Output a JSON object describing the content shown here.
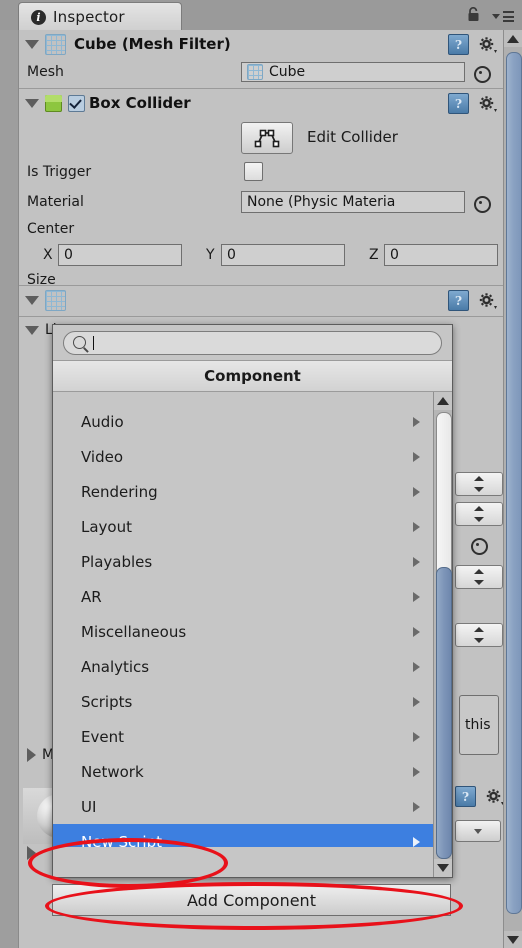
{
  "window": {
    "tab_label": "Inspector",
    "tab_icon": "info-circle-icon",
    "lock_icon": "lock-icon",
    "menu_icon": "hamburger-menu-icon"
  },
  "components": [
    {
      "id": "mesh-filter",
      "title": "Cube (Mesh Filter)",
      "icon": "mesh-filter-icon",
      "help_glyph": "?",
      "rows": [
        {
          "label": "Mesh",
          "value": "Cube",
          "picker": "object-picker-icon"
        }
      ]
    },
    {
      "id": "box-collider",
      "title": "Box Collider",
      "icon": "box-collider-icon",
      "enabled": true,
      "help_glyph": "?",
      "edit_collider_label": "Edit Collider",
      "edit_collider_icon": "polygon-edit-icon",
      "rows": [
        {
          "label": "Is Trigger",
          "type": "checkbox",
          "value": false
        },
        {
          "label": "Material",
          "value": "None (Physic Materia",
          "picker": "object-picker-icon"
        },
        {
          "label": "Center",
          "type": "vector3",
          "x": "0",
          "y": "0",
          "z": "0"
        },
        {
          "label": "Size",
          "type": "vector3"
        }
      ],
      "axis_labels": {
        "x": "X",
        "y": "Y",
        "z": "Z"
      }
    },
    {
      "id": "light",
      "title": "Li",
      "icon": "light-icon"
    },
    {
      "id": "material-collapsed",
      "title": "M"
    }
  ],
  "obscured": {
    "help_text_fragment": "this"
  },
  "popup": {
    "title": "Component",
    "search_placeholder": "",
    "search_value": "",
    "search_icon": "search-icon",
    "items": [
      {
        "label": "Audio",
        "has_submenu": true,
        "selected": false
      },
      {
        "label": "Video",
        "has_submenu": true,
        "selected": false
      },
      {
        "label": "Rendering",
        "has_submenu": true,
        "selected": false
      },
      {
        "label": "Layout",
        "has_submenu": true,
        "selected": false
      },
      {
        "label": "Playables",
        "has_submenu": true,
        "selected": false
      },
      {
        "label": "AR",
        "has_submenu": true,
        "selected": false
      },
      {
        "label": "Miscellaneous",
        "has_submenu": true,
        "selected": false
      },
      {
        "label": "Analytics",
        "has_submenu": true,
        "selected": false
      },
      {
        "label": "Scripts",
        "has_submenu": true,
        "selected": false
      },
      {
        "label": "Event",
        "has_submenu": true,
        "selected": false
      },
      {
        "label": "Network",
        "has_submenu": true,
        "selected": false
      },
      {
        "label": "UI",
        "has_submenu": true,
        "selected": false
      },
      {
        "label": "New Script",
        "has_submenu": true,
        "selected": true
      }
    ],
    "scrollbar": {
      "up_icon": "scroll-up-arrow-icon",
      "down_icon": "scroll-down-arrow-icon"
    }
  },
  "add_component_button": {
    "label": "Add Component"
  },
  "annotations": {
    "color": "#e8111a",
    "items": [
      {
        "target": "New Script"
      },
      {
        "target": "Add Component"
      }
    ]
  },
  "inspector_scrollbar": {
    "up_icon": "scroll-up-arrow-icon",
    "down_icon": "scroll-down-arrow-icon"
  }
}
